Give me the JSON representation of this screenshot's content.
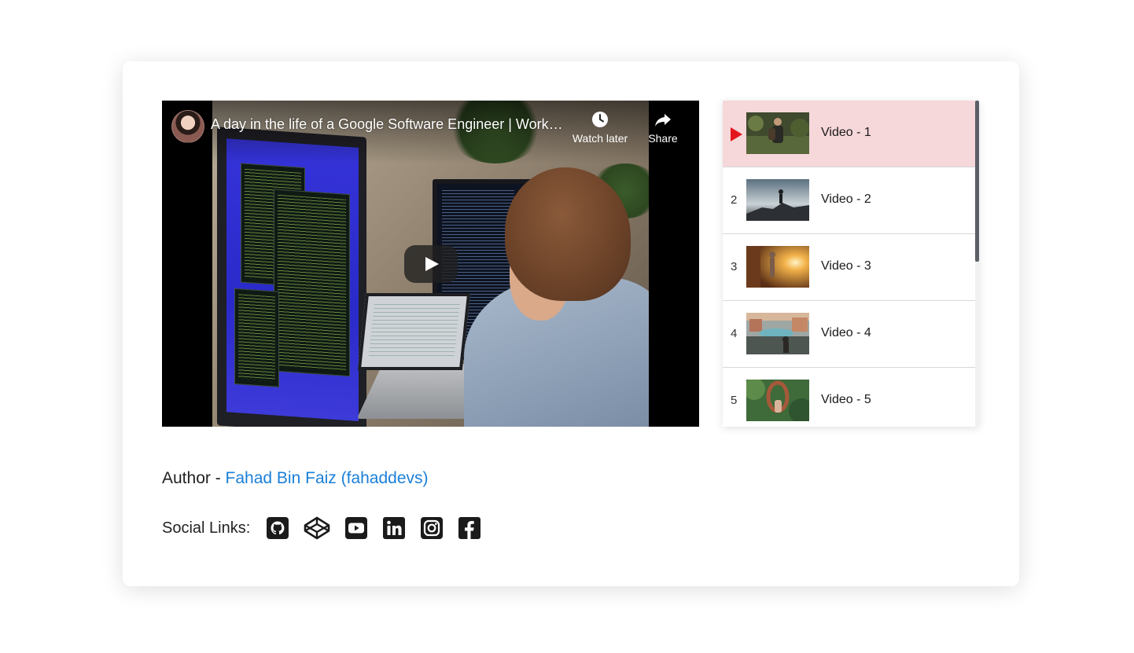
{
  "player": {
    "title": "A day in the life of a Google Software Engineer | Work-f…",
    "watch_later_label": "Watch later",
    "share_label": "Share"
  },
  "playlist": {
    "items": [
      {
        "index": "1",
        "label": "Video - 1",
        "active": true
      },
      {
        "index": "2",
        "label": "Video - 2",
        "active": false
      },
      {
        "index": "3",
        "label": "Video - 3",
        "active": false
      },
      {
        "index": "4",
        "label": "Video - 4",
        "active": false
      },
      {
        "index": "5",
        "label": "Video - 5",
        "active": false
      }
    ]
  },
  "author": {
    "prefix": "Author - ",
    "name": "Fahad Bin Faiz (fahaddevs)"
  },
  "social": {
    "label": "Social Links:",
    "icons": [
      "github-icon",
      "codepen-icon",
      "youtube-icon",
      "linkedin-icon",
      "instagram-icon",
      "facebook-icon"
    ]
  },
  "colors": {
    "active_row_bg": "#f6d7da",
    "active_play": "#e4161d",
    "author_link": "#1a7fd8"
  }
}
